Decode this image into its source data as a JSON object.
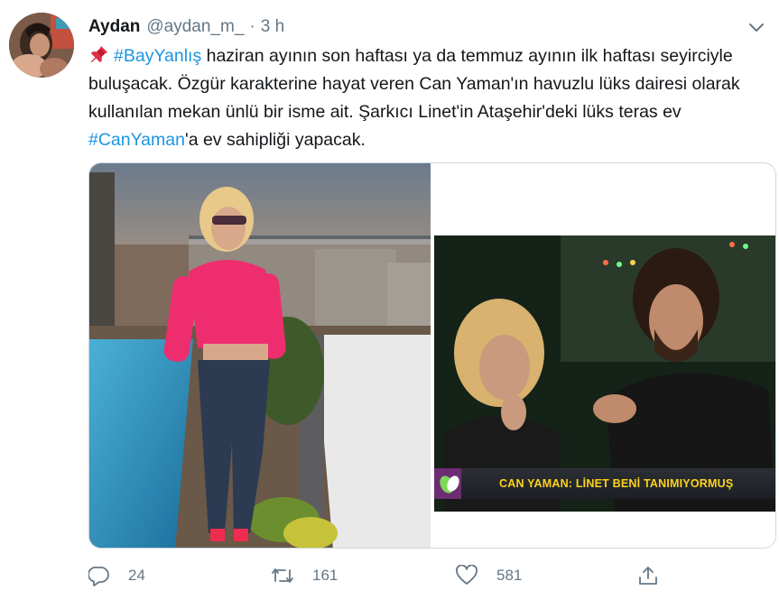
{
  "tweet": {
    "author_name": "Aydan",
    "author_handle": "@aydan_m_",
    "separator": "·",
    "timestamp": "3 h",
    "text_segments": {
      "hashtag1": "#BayYanlış",
      "part1": " haziran ayının son haftası ya da temmuz ayının ilk haftası seyirciyle buluşacak. Özgür karakterine hayat veren Can Yaman'ın havuzlu lüks dairesi olarak kullanılan mekan ünlü bir isme ait. Şarkıcı Linet'in Ataşehir'deki lüks teras ev ",
      "hashtag2": "#CanYaman",
      "part2": "'a ev sahipliği yapacak."
    },
    "media": {
      "tv_caption": "CAN YAMAN: LİNET BENİ TANIMIYORMUŞ"
    },
    "actions": {
      "reply_count": "24",
      "retweet_count": "161",
      "like_count": "581"
    },
    "icons": {
      "pin": "pushpin-icon",
      "reply": "reply-icon",
      "retweet": "retweet-icon",
      "like": "heart-icon",
      "share": "share-icon",
      "more": "chevron-down-icon"
    },
    "colors": {
      "link": "#1b95e0",
      "muted": "#657786",
      "text": "#14171a",
      "border": "#ccd6dd"
    }
  }
}
